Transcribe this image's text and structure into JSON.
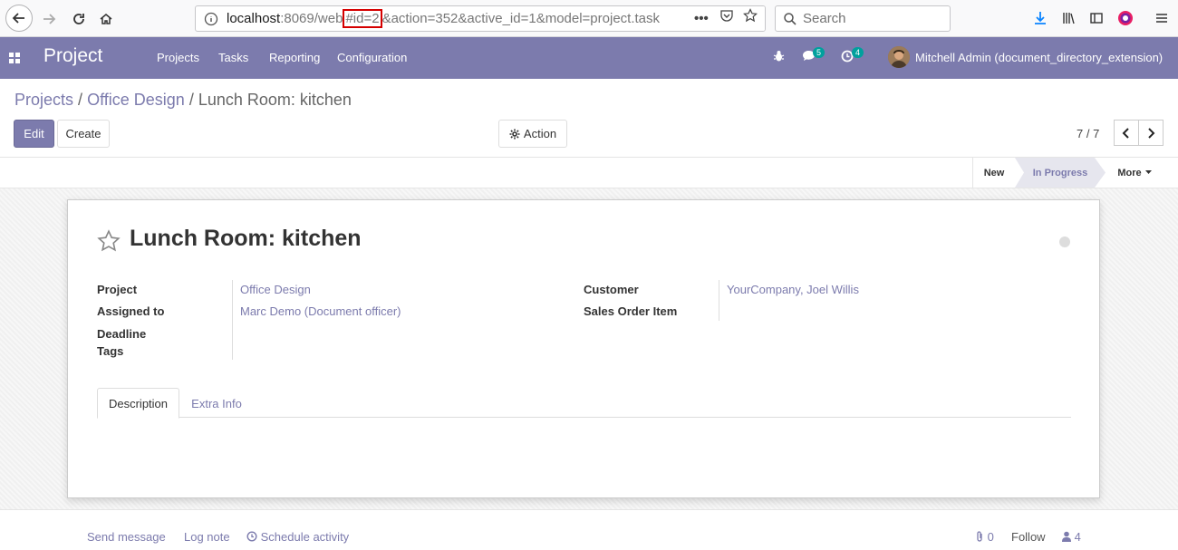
{
  "browser": {
    "url_host": "localhost",
    "url_pre": ":8069/web",
    "url_highlight": "#id=2",
    "url_post": "&action=352&active_id=1&model=project.task",
    "search_placeholder": "Search"
  },
  "app": {
    "brand": "Project",
    "menu": [
      "Projects",
      "Tasks",
      "Reporting",
      "Configuration"
    ],
    "messages_count": "5",
    "activities_count": "4",
    "user_name": "Mitchell Admin (document_directory_extension)"
  },
  "breadcrumb": {
    "items": [
      "Projects",
      "Office Design"
    ],
    "current": "Lunch Room: kitchen",
    "sep": "/"
  },
  "controls": {
    "edit": "Edit",
    "create": "Create",
    "action": "Action",
    "pager": "7 / 7"
  },
  "stages": {
    "new": "New",
    "in_progress": "In Progress",
    "more": "More"
  },
  "task": {
    "title": "Lunch Room: kitchen",
    "fields_left": [
      {
        "label": "Project",
        "value": "Office Design"
      },
      {
        "label": "Assigned to",
        "value": "Marc Demo (Document officer)"
      },
      {
        "label": "Deadline",
        "value": ""
      },
      {
        "label": "Tags",
        "value": ""
      }
    ],
    "fields_right": [
      {
        "label": "Customer",
        "value": "YourCompany, Joel Willis"
      },
      {
        "label": "Sales Order Item",
        "value": ""
      }
    ],
    "tabs": [
      "Description",
      "Extra Info"
    ]
  },
  "chatter": {
    "send_message": "Send message",
    "log_note": "Log note",
    "schedule_activity": "Schedule activity",
    "attachments": "0",
    "follow": "Follow",
    "followers": "4"
  },
  "colors": {
    "brand": "#7c7bad",
    "badge": "#00a09d",
    "highlight_box": "#d50000"
  }
}
